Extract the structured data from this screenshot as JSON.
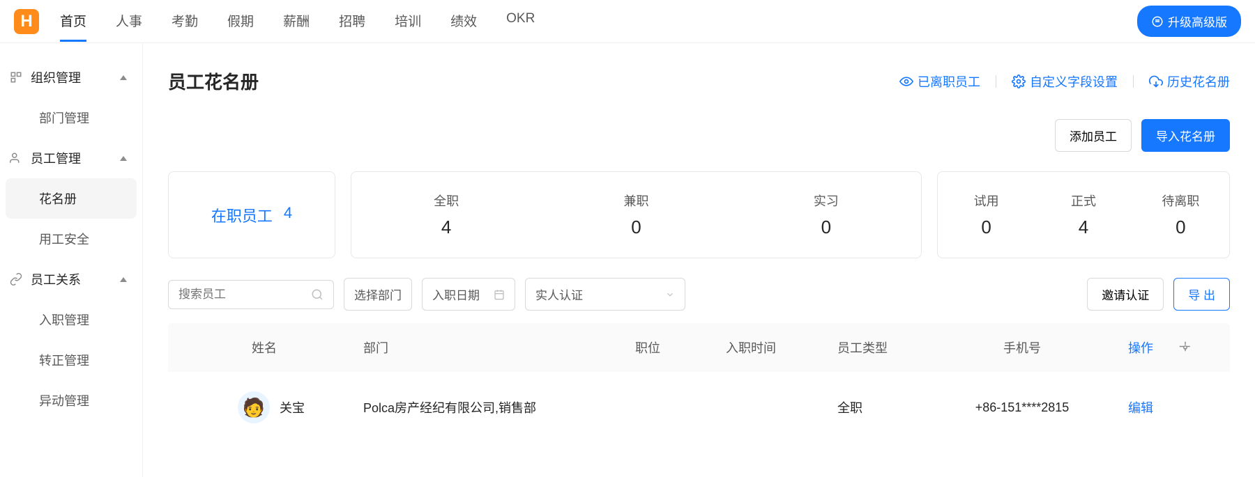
{
  "logo": "H",
  "topNav": {
    "items": [
      "首页",
      "人事",
      "考勤",
      "假期",
      "薪酬",
      "招聘",
      "培训",
      "绩效",
      "OKR"
    ],
    "activeIndex": 0
  },
  "upgradeLabel": "升级高级版",
  "sidebar": {
    "groups": [
      {
        "label": "组织管理",
        "expanded": true,
        "children": [
          "部门管理"
        ]
      },
      {
        "label": "员工管理",
        "expanded": true,
        "children": [
          "花名册",
          "用工安全"
        ],
        "activeChild": 0
      },
      {
        "label": "员工关系",
        "expanded": true,
        "children": [
          "入职管理",
          "转正管理",
          "异动管理"
        ]
      }
    ]
  },
  "page": {
    "title": "员工花名册",
    "actions": {
      "resigned": "已离职员工",
      "customFields": "自定义字段设置",
      "historyRoster": "历史花名册"
    },
    "buttons": {
      "add": "添加员工",
      "import": "导入花名册"
    }
  },
  "stats": {
    "main": {
      "label": "在职员工",
      "value": "4"
    },
    "byType": [
      {
        "label": "全职",
        "value": "4"
      },
      {
        "label": "兼职",
        "value": "0"
      },
      {
        "label": "实习",
        "value": "0"
      }
    ],
    "byStatus": [
      {
        "label": "试用",
        "value": "0"
      },
      {
        "label": "正式",
        "value": "4"
      },
      {
        "label": "待离职",
        "value": "0"
      }
    ]
  },
  "filters": {
    "searchPlaceholder": "搜索员工",
    "selectDept": "选择部门",
    "hireDate": "入职日期",
    "realName": "实人认证",
    "inviteAuth": "邀请认证",
    "export": "导 出"
  },
  "table": {
    "headers": {
      "name": "姓名",
      "dept": "部门",
      "position": "职位",
      "hireDate": "入职时间",
      "type": "员工类型",
      "phone": "手机号",
      "op": "操作"
    },
    "rows": [
      {
        "name": "关宝",
        "dept": "Polca房产经纪有限公司,销售部",
        "position": "",
        "hireDate": "",
        "type": "全职",
        "phone": "+86-151****2815",
        "op": "编辑"
      }
    ]
  }
}
